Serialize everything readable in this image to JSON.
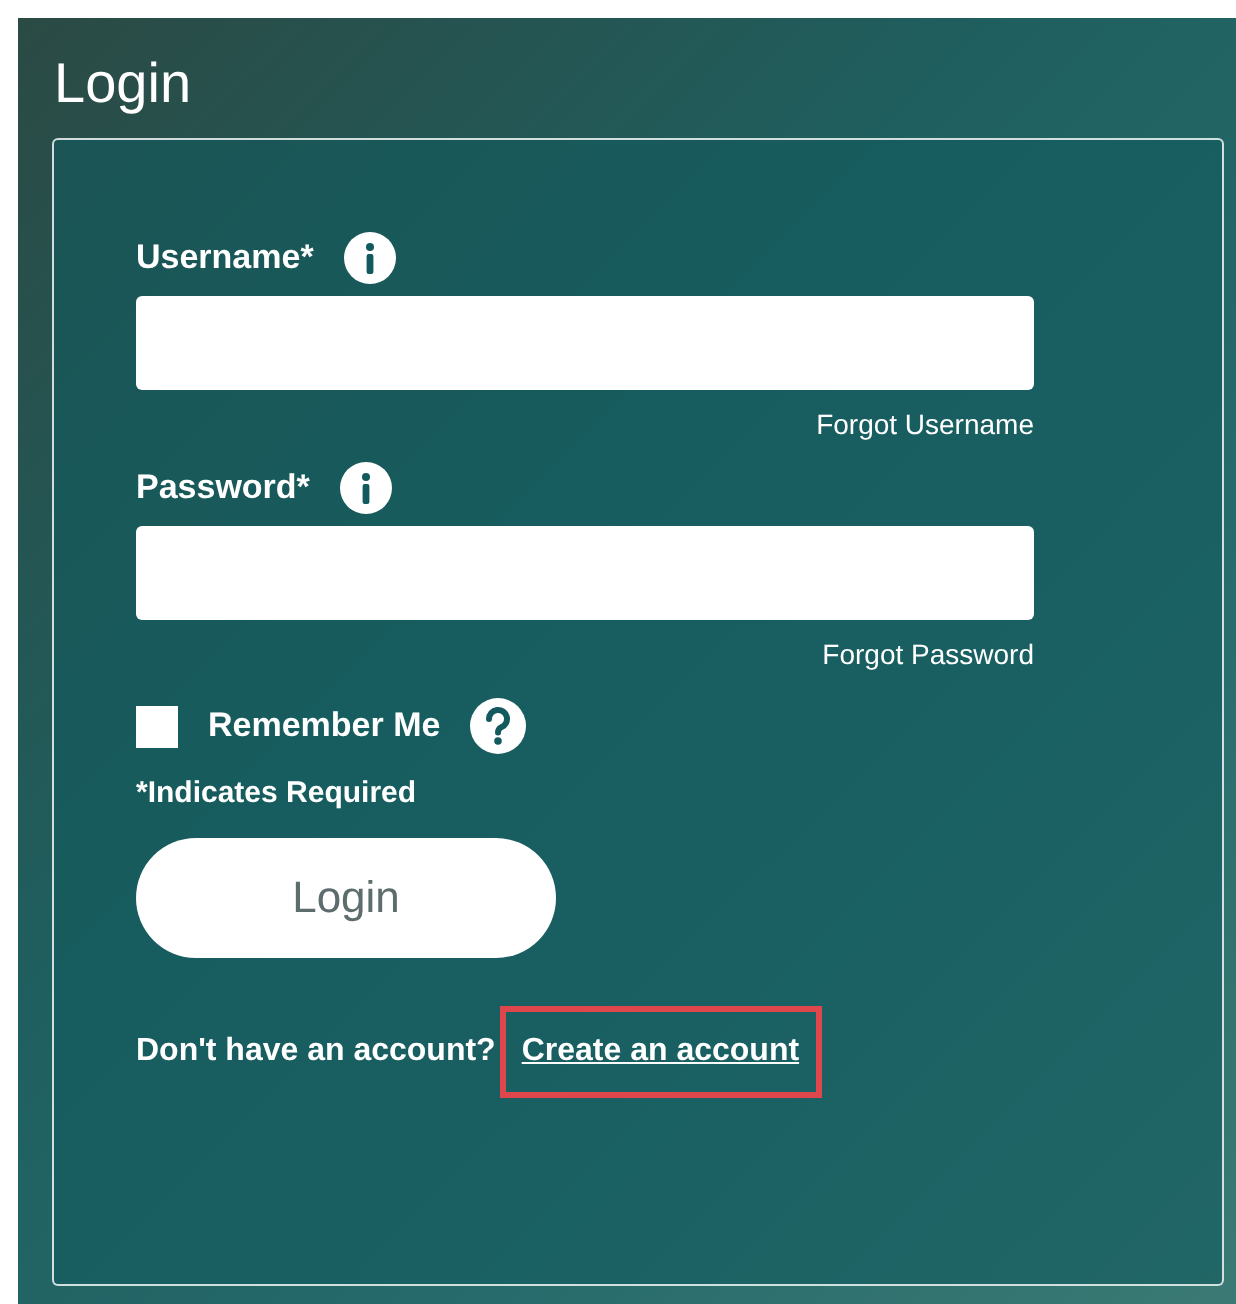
{
  "title": "Login",
  "fields": [
    {
      "label": "Username*",
      "link": "Forgot Username"
    },
    {
      "label": "Password*",
      "link": "Forgot Password"
    }
  ],
  "remember": {
    "label": "Remember Me",
    "checked": false
  },
  "required_note": "*Indicates Required",
  "login_button": "Login",
  "signup": {
    "text": "Don't have an account?",
    "link": "Create an account",
    "highlighted": true
  }
}
